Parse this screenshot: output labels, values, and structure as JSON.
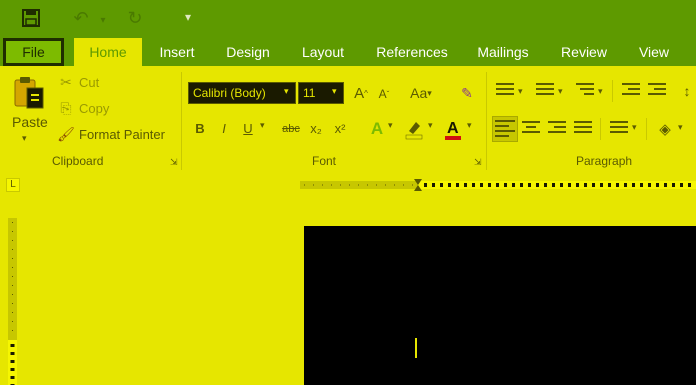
{
  "colors": {
    "title_bar": "#5e9a00",
    "ribbon": "#e6e600",
    "page": "#000000"
  },
  "qat": [
    {
      "name": "save-icon",
      "glyph": "💾"
    },
    {
      "name": "undo-icon",
      "glyph": "↶"
    },
    {
      "name": "redo-icon",
      "glyph": "↻"
    },
    {
      "name": "customize-qat-icon",
      "glyph": "▾"
    }
  ],
  "tabs": {
    "file": "File",
    "home": "Home",
    "insert": "Insert",
    "design": "Design",
    "layout": "Layout",
    "references": "References",
    "mailings": "Mailings",
    "review": "Review",
    "view": "View"
  },
  "clipboard": {
    "paste": "Paste",
    "cut": "Cut",
    "copy": "Copy",
    "format_painter": "Format Painter",
    "group_label": "Clipboard"
  },
  "font": {
    "font_name": "Calibri (Body)",
    "font_size": "11",
    "group_label": "Font",
    "grow_glyph": "A",
    "shrink_glyph": "A",
    "case_glyph": "Aa",
    "bold": "B",
    "italic": "I",
    "underline": "U",
    "strikethrough": "abc",
    "subscript": "x₂",
    "superscript": "x²"
  },
  "paragraph": {
    "group_label": "Paragraph"
  },
  "ruler": {
    "corner_glyph": "L"
  }
}
